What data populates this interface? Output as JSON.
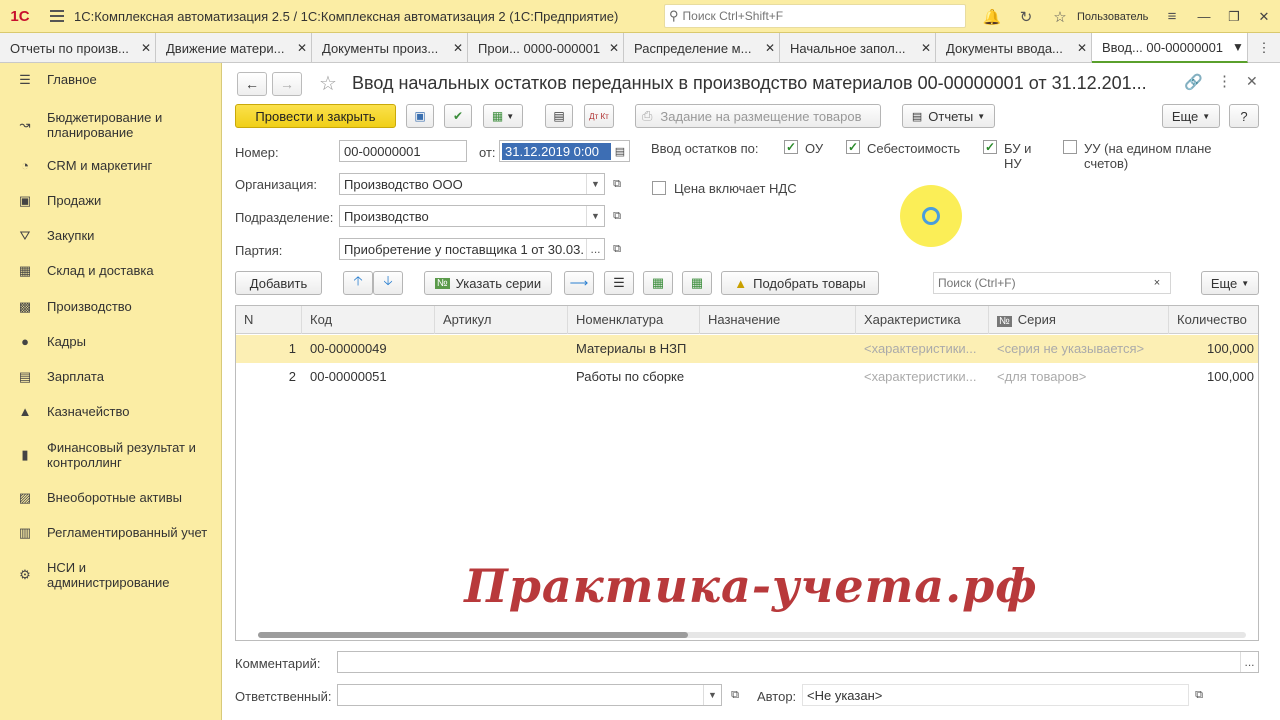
{
  "app": {
    "logo": "1С",
    "title": "1С:Комплексная автоматизация 2.5 / 1С:Комплексная автоматизация 2  (1С:Предприятие)",
    "search_placeholder": "Поиск Ctrl+Shift+F",
    "user": "Пользователь"
  },
  "tabs": [
    {
      "label": "Отчеты по произв...",
      "active": false
    },
    {
      "label": "Движение матери...",
      "active": false
    },
    {
      "label": "Документы произ...",
      "active": false
    },
    {
      "label": "Прои... 0000-000001",
      "active": false
    },
    {
      "label": "Распределение м...",
      "active": false
    },
    {
      "label": "Начальное запол...",
      "active": false
    },
    {
      "label": "Документы ввода...",
      "active": false
    },
    {
      "label": "Ввод... 00-00000001",
      "active": true
    }
  ],
  "sidebar": {
    "items": [
      {
        "label": "Главное",
        "icon": "menu-lines-icon"
      },
      {
        "label": "Бюджетирование и планирование",
        "icon": "chart-trend-icon"
      },
      {
        "label": "CRM и маркетинг",
        "icon": "pie-chart-icon"
      },
      {
        "label": "Продажи",
        "icon": "shopping-bag-icon"
      },
      {
        "label": "Закупки",
        "icon": "cart-icon"
      },
      {
        "label": "Склад и доставка",
        "icon": "warehouse-grid-icon"
      },
      {
        "label": "Производство",
        "icon": "factory-icon"
      },
      {
        "label": "Кадры",
        "icon": "person-icon"
      },
      {
        "label": "Зарплата",
        "icon": "wallet-icon"
      },
      {
        "label": "Казначейство",
        "icon": "bank-icon"
      },
      {
        "label": "Финансовый результат и контроллинг",
        "icon": "bar-chart-icon"
      },
      {
        "label": "Внеоборотные активы",
        "icon": "assets-icon"
      },
      {
        "label": "Регламентированный учет",
        "icon": "ledger-icon"
      },
      {
        "label": "НСИ и администрирование",
        "icon": "gear-icon"
      }
    ]
  },
  "document": {
    "title": "Ввод начальных остатков переданных в производство материалов 00-00000001 от 31.12.201...",
    "toolbar": {
      "post_close": "Провести и закрыть",
      "placement_task": "Задание на размещение товаров",
      "reports": "Отчеты",
      "more": "Еще",
      "help": "?",
      "dt_kt": "Дт Кт"
    },
    "fields": {
      "number_label": "Номер:",
      "number_value": "00-00000001",
      "date_label": "от:",
      "date_value": "31.12.2019  0:00",
      "org_label": "Организация:",
      "org_value": "Производство ООО",
      "dept_label": "Подразделение:",
      "dept_value": "Производство",
      "batch_label": "Партия:",
      "batch_value": "Приобретение у поставщика 1 от 30.03.",
      "ellipsis": "..."
    },
    "balance_by": {
      "label": "Ввод остатков по:",
      "ou": {
        "label": "ОУ",
        "checked": true
      },
      "cost": {
        "label": "Себестоимость",
        "checked": true
      },
      "bu_nu": {
        "label": "БУ и НУ",
        "checked": true
      },
      "uu": {
        "label": "УУ (на едином плане счетов)",
        "checked": false
      }
    },
    "vat": {
      "label": "Цена включает НДС",
      "checked": false
    },
    "table_toolbar": {
      "add": "Добавить",
      "specify_series": "Указать серии",
      "pick_goods": "Подобрать товары",
      "search_placeholder": "Поиск (Ctrl+F)",
      "clear": "×",
      "more": "Еще"
    },
    "table": {
      "columns": [
        "N",
        "Код",
        "Артикул",
        "Номенклатура",
        "Назначение",
        "Характеристика",
        "Серия",
        "Количество"
      ],
      "series_icon_text": "№",
      "rows": [
        {
          "n": "1",
          "code": "00-00000049",
          "article": "",
          "item": "Материалы в НЗП",
          "purpose": "",
          "characteristic": "<характеристики...",
          "series": "<серия не указывается>",
          "qty": "100,000"
        },
        {
          "n": "2",
          "code": "00-00000051",
          "article": "",
          "item": "Работы по сборке",
          "purpose": "",
          "characteristic": "<характеристики...",
          "series": "<для товаров>",
          "qty": "100,000"
        }
      ],
      "selected_row": 0
    },
    "footer": {
      "comment_label": "Комментарий:",
      "comment_value": "",
      "responsible_label": "Ответственный:",
      "responsible_value": "",
      "author_label": "Автор:",
      "author_value": "<Не указан>"
    }
  },
  "watermark": "Практика-учета.рф",
  "colors": {
    "sidebar_bg": "#fbeda4",
    "primary_button": "#f0cf18",
    "selected_row": "#fcefb4",
    "watermark": "#b8393b",
    "active_tab_underline": "#5aa02c"
  }
}
